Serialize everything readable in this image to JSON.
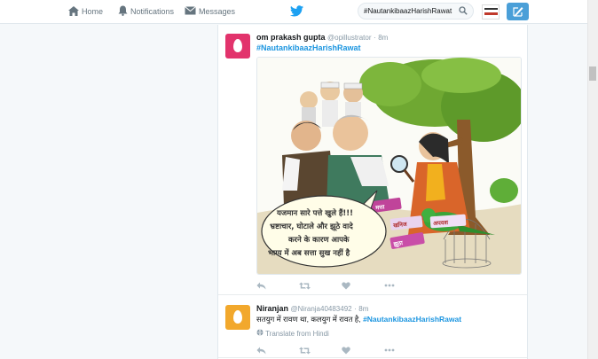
{
  "nav": {
    "home_label": "Home",
    "notifications_label": "Notifications",
    "messages_label": "Messages"
  },
  "search": {
    "value": "#NautankibaazHarishRawat"
  },
  "tweets": [
    {
      "name": "om prakash gupta",
      "handle": "@opillustrator",
      "dot": "·",
      "time": "8m",
      "hashtag": "#NautankibaazHarishRawat",
      "cartoon": {
        "bubble_lines": [
          "यजमान सारे पत्ते खुले हैं!!!",
          "भ्रष्टाचार, घोटाले और झूठे वादे",
          "करने के कारण आपके",
          "भाग्य में अब सत्ता सुख नहीं है"
        ],
        "signs": [
          "मत्ता",
          "बेइमान",
          "जनलोक",
          "खनिज",
          "अपयश",
          "झूठा"
        ]
      },
      "avatar_color": "#e2336c"
    },
    {
      "name": "Niranjan",
      "handle": "@Niranja40483492",
      "dot": "·",
      "time": "8m",
      "text": "सतयुग में रावण था, कलयुग में रावत है,",
      "hashtag": "#NautankibaazHarishRawat",
      "translate": "Translate from Hindi",
      "avatar_color": "#f2a82c"
    }
  ],
  "colors": {
    "link": "#1b95e0",
    "compose": "#4a9fd8"
  }
}
